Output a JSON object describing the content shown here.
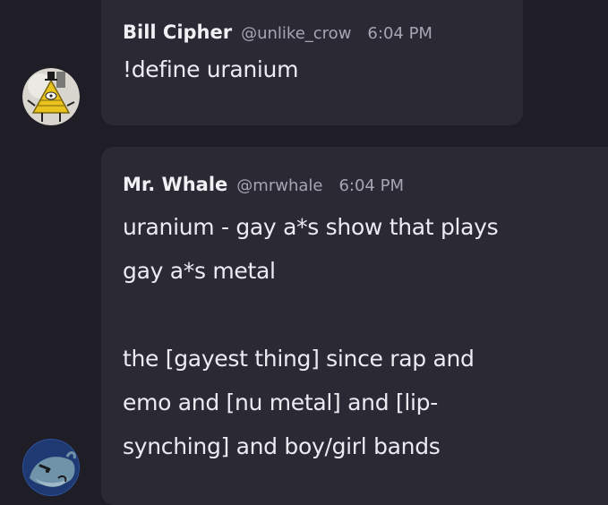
{
  "messages": [
    {
      "username": "Bill Cipher",
      "handle": "@unlike_crow",
      "time": "6:04 PM",
      "text": "!define uranium",
      "avatar_icon": "bill-cipher-triangle-avatar"
    },
    {
      "username": "Mr. Whale",
      "handle": "@mrwhale",
      "time": "6:04 PM",
      "text": "uranium - gay a*s show that plays\ngay a*s metal\n\nthe [gayest thing] since rap and\nemo and [nu metal] and [lip-\nsynching] and boy/girl bands",
      "avatar_icon": "whale-avatar"
    }
  ],
  "colors": {
    "background": "#1f1e26",
    "bubble": "#2b2a34",
    "muted_text": "#a7a5b4"
  }
}
